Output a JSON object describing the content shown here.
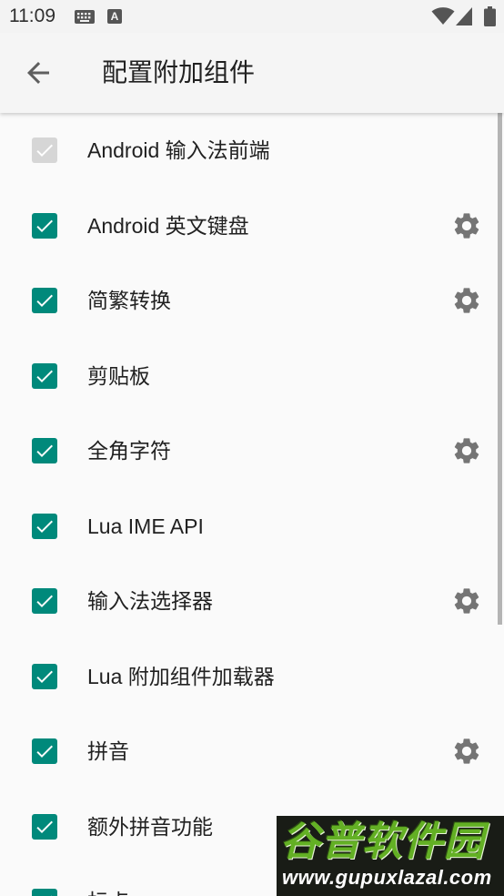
{
  "status_bar": {
    "time": "11:09",
    "a_icon_label": "A",
    "icons": [
      "keyboard-icon",
      "a-icon",
      "wifi-icon",
      "signal-icon",
      "battery-icon"
    ]
  },
  "app_bar": {
    "title": "配置附加组件",
    "back_icon": "arrow-back-icon"
  },
  "colors": {
    "accent": "#00897B",
    "disabled_checkbox": "#D6D6D6",
    "settings_icon": "#757575",
    "app_bar_bg": "#F5F5F5",
    "list_bg": "#FAFAFA"
  },
  "plugins": [
    {
      "label": "Android 输入法前端",
      "checked": true,
      "enabled": false,
      "has_settings": false
    },
    {
      "label": "Android 英文键盘",
      "checked": true,
      "enabled": true,
      "has_settings": true
    },
    {
      "label": "简繁转换",
      "checked": true,
      "enabled": true,
      "has_settings": true
    },
    {
      "label": "剪贴板",
      "checked": true,
      "enabled": true,
      "has_settings": false
    },
    {
      "label": "全角字符",
      "checked": true,
      "enabled": true,
      "has_settings": true
    },
    {
      "label": "Lua IME API",
      "checked": true,
      "enabled": true,
      "has_settings": false
    },
    {
      "label": "输入法选择器",
      "checked": true,
      "enabled": true,
      "has_settings": true
    },
    {
      "label": "Lua 附加组件加载器",
      "checked": true,
      "enabled": true,
      "has_settings": false
    },
    {
      "label": "拼音",
      "checked": true,
      "enabled": true,
      "has_settings": true
    },
    {
      "label": "额外拼音功能",
      "checked": true,
      "enabled": true,
      "has_settings": false
    },
    {
      "label": "标点",
      "checked": true,
      "enabled": true,
      "has_settings": false
    }
  ],
  "watermark": {
    "title": "谷普软件园",
    "url": "www.gupuxlazal.com"
  }
}
